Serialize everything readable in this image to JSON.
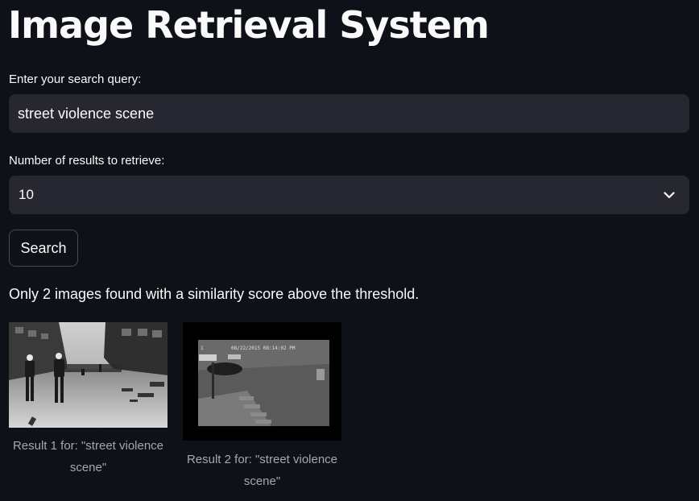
{
  "page": {
    "title": "Image Retrieval System"
  },
  "search": {
    "query_label": "Enter your search query:",
    "query_value": "street violence scene",
    "num_label": "Number of results to retrieve:",
    "num_value": "10",
    "button_label": "Search"
  },
  "results": {
    "info_text": "Only 2 images found with a similarity score above the threshold.",
    "items": [
      {
        "caption": "Result 1 for: \"street violence scene\""
      },
      {
        "caption": "Result 2 for: \"street violence scene\"",
        "timestamp": "08/22/2015 08:14:02 PM"
      }
    ]
  },
  "colors": {
    "background": "#0e1117",
    "input_background": "#262730",
    "text": "#fafafa",
    "caption": "#a3a8b4"
  },
  "icons": {
    "select_arrow": "chevron-down-icon"
  }
}
